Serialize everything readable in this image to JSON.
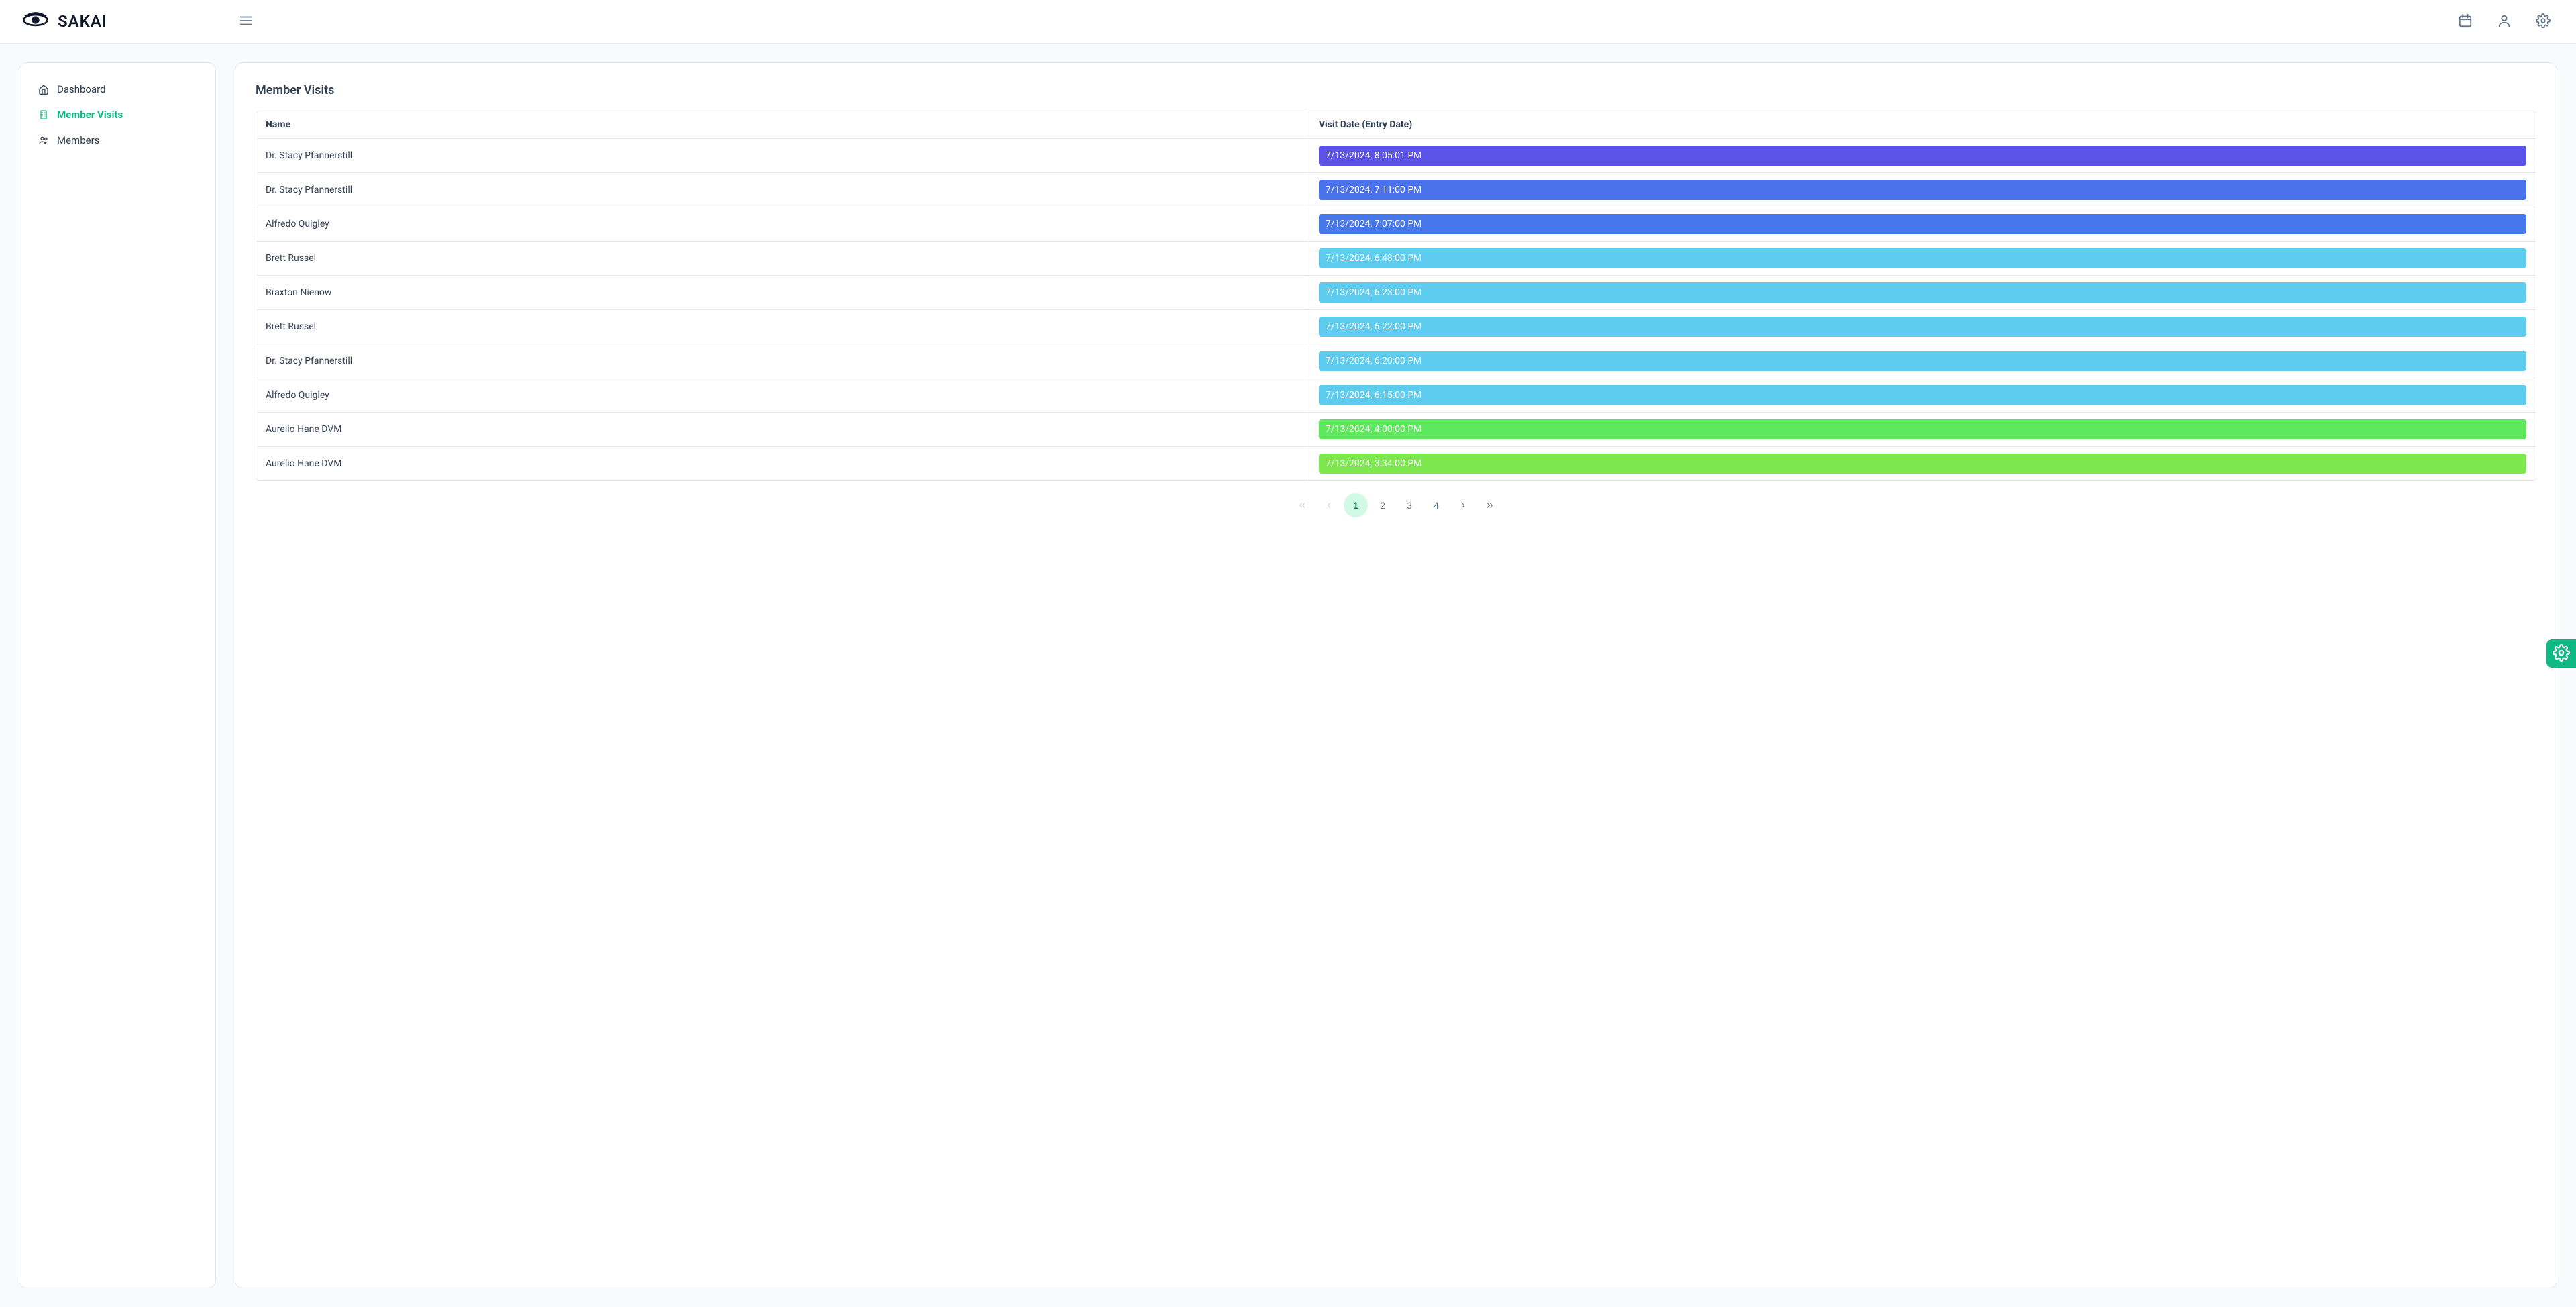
{
  "brand": "SAKAI",
  "sidebar": {
    "items": [
      {
        "label": "Dashboard",
        "icon": "home-icon",
        "active": false
      },
      {
        "label": "Member Visits",
        "icon": "building-icon",
        "active": true
      },
      {
        "label": "Members",
        "icon": "users-icon",
        "active": false
      }
    ]
  },
  "page": {
    "title": "Member Visits"
  },
  "table": {
    "columns": {
      "name": "Name",
      "visit_date": "Visit Date (Entry Date)"
    },
    "rows": [
      {
        "name": "Dr. Stacy Pfannerstill",
        "date": "7/13/2024, 8:05:01 PM",
        "color": "#5b52e8"
      },
      {
        "name": "Dr. Stacy Pfannerstill",
        "date": "7/13/2024, 7:11:00 PM",
        "color": "#4a72ea"
      },
      {
        "name": "Alfredo Quigley",
        "date": "7/13/2024, 7:07:00 PM",
        "color": "#4778eb"
      },
      {
        "name": "Brett Russel",
        "date": "7/13/2024, 6:48:00 PM",
        "color": "#5dccee"
      },
      {
        "name": "Braxton Nienow",
        "date": "7/13/2024, 6:23:00 PM",
        "color": "#5dccee"
      },
      {
        "name": "Brett Russel",
        "date": "7/13/2024, 6:22:00 PM",
        "color": "#5dccee"
      },
      {
        "name": "Dr. Stacy Pfannerstill",
        "date": "7/13/2024, 6:20:00 PM",
        "color": "#5dccee"
      },
      {
        "name": "Alfredo Quigley",
        "date": "7/13/2024, 6:15:00 PM",
        "color": "#5dccee"
      },
      {
        "name": "Aurelio Hane DVM",
        "date": "7/13/2024, 4:00:00 PM",
        "color": "#5de85d"
      },
      {
        "name": "Aurelio Hane DVM",
        "date": "7/13/2024, 3:34:00 PM",
        "color": "#7de84d"
      }
    ]
  },
  "paginator": {
    "pages": [
      "1",
      "2",
      "3",
      "4"
    ],
    "active": "1"
  }
}
